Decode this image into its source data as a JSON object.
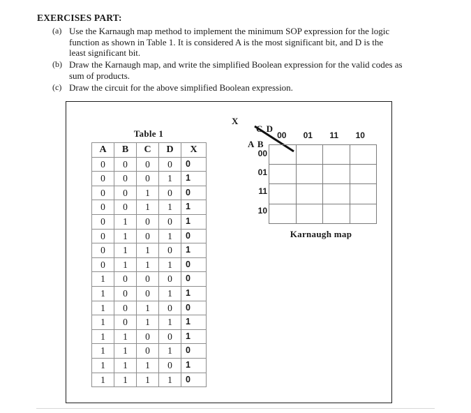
{
  "document": {
    "heading": "EXERCISES PART:",
    "items": [
      {
        "marker": "(a)",
        "lines": [
          "Use the Karnaugh map method to implement the minimum SOP expression for the logic",
          "function as shown in Table 1. It is considered A is the most significant bit, and D is the",
          "least significant bit."
        ]
      },
      {
        "marker": "(b)",
        "lines": [
          "Draw the Karnaugh map, and write the simplified Boolean expression for the valid codes as",
          "sum of products."
        ]
      },
      {
        "marker": "(c)",
        "lines": [
          "Draw the circuit for the above simplified Boolean expression."
        ]
      }
    ]
  },
  "truth_table": {
    "caption": "Table 1",
    "columns": [
      "A",
      "B",
      "C",
      "D",
      "X"
    ],
    "rows": [
      [
        "0",
        "0",
        "0",
        "0",
        "0"
      ],
      [
        "0",
        "0",
        "0",
        "1",
        "1"
      ],
      [
        "0",
        "0",
        "1",
        "0",
        "0"
      ],
      [
        "0",
        "0",
        "1",
        "1",
        "1"
      ],
      [
        "0",
        "1",
        "0",
        "0",
        "1"
      ],
      [
        "0",
        "1",
        "0",
        "1",
        "0"
      ],
      [
        "0",
        "1",
        "1",
        "0",
        "1"
      ],
      [
        "0",
        "1",
        "1",
        "1",
        "0"
      ],
      [
        "1",
        "0",
        "0",
        "0",
        "0"
      ],
      [
        "1",
        "0",
        "0",
        "1",
        "1"
      ],
      [
        "1",
        "0",
        "1",
        "0",
        "0"
      ],
      [
        "1",
        "0",
        "1",
        "1",
        "1"
      ],
      [
        "1",
        "1",
        "0",
        "0",
        "1"
      ],
      [
        "1",
        "1",
        "0",
        "1",
        "0"
      ],
      [
        "1",
        "1",
        "1",
        "0",
        "1"
      ],
      [
        "1",
        "1",
        "1",
        "1",
        "0"
      ]
    ]
  },
  "karnaugh_map": {
    "output_label": "X",
    "col_var_label": "C D",
    "row_var_label": "A B",
    "col_headers": [
      "00",
      "01",
      "11",
      "10"
    ],
    "row_headers": [
      "00",
      "01",
      "11",
      "10"
    ],
    "cells": [
      [
        "",
        "",
        "",
        ""
      ],
      [
        "",
        "",
        "",
        ""
      ],
      [
        "",
        "",
        "",
        ""
      ],
      [
        "",
        "",
        "",
        ""
      ]
    ],
    "caption": "Karnaugh map"
  },
  "colors": {
    "page_background": "#ffffff",
    "text": "#1a1a1a",
    "box_border": "#1d1d1d",
    "grid_line": "#7b7b7b",
    "rule": "#d8d8d8"
  }
}
